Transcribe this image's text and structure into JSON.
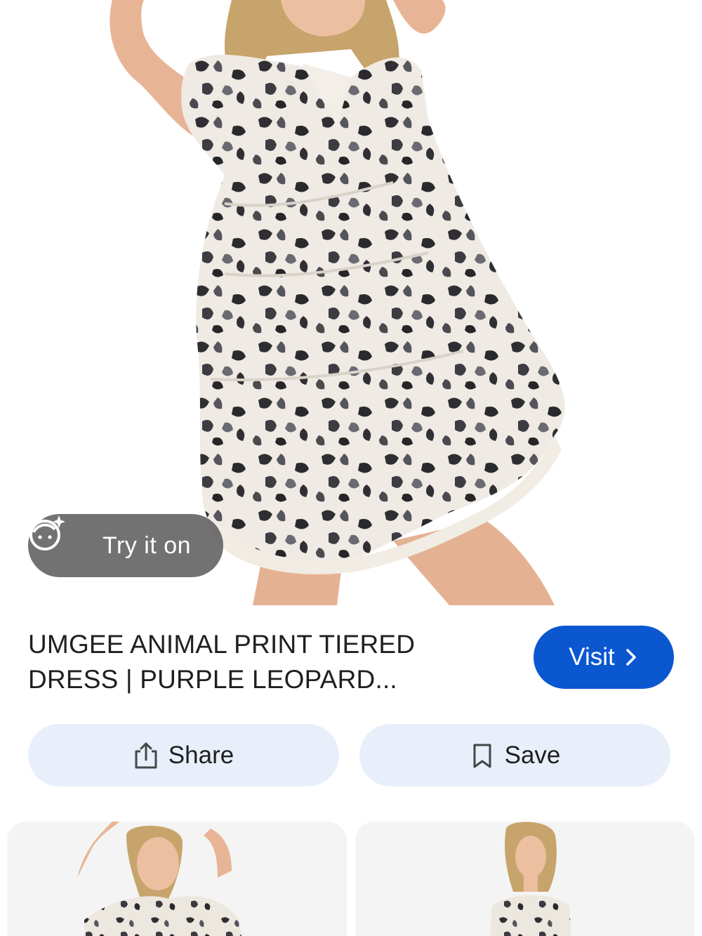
{
  "hero": {
    "try_on_label": "Try it on",
    "icon": "face-sparkle-icon"
  },
  "product": {
    "title_line1": "UMGEE ANIMAL PRINT TIERED",
    "title_line2": "DRESS | PURPLE LEOPARD..."
  },
  "actions": {
    "visit_label": "Visit",
    "visit_icon": "chevron-right-icon",
    "share_label": "Share",
    "share_icon": "share-icon",
    "save_label": "Save",
    "save_icon": "bookmark-icon"
  },
  "colors": {
    "accent": "#0b57d0",
    "action_bg": "#e8effb",
    "text": "#1f1f1f"
  }
}
